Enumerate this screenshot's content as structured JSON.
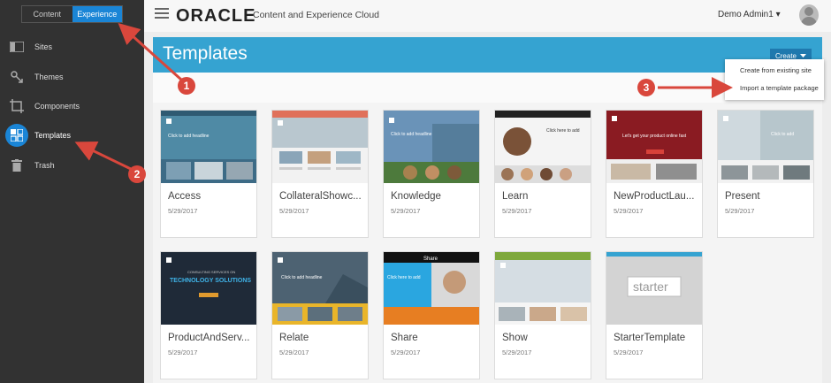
{
  "sidebar": {
    "switch": {
      "content": "Content",
      "experience": "Experience"
    },
    "items": [
      {
        "label": "Sites",
        "icon": "sites-icon"
      },
      {
        "label": "Themes",
        "icon": "themes-icon"
      },
      {
        "label": "Components",
        "icon": "components-icon"
      },
      {
        "label": "Templates",
        "icon": "templates-icon"
      },
      {
        "label": "Trash",
        "icon": "trash-icon"
      }
    ]
  },
  "header": {
    "brand": "ORACLE",
    "brand_sub": "Content and Experience Cloud",
    "user": "Demo Admin1 ▾"
  },
  "banner": {
    "title": "Templates",
    "create": "Create"
  },
  "dropdown": {
    "items": [
      "Create from existing site",
      "Import a template package"
    ]
  },
  "templates": [
    {
      "name": "Access",
      "date": "5/29/2017"
    },
    {
      "name": "CollateralShowc...",
      "date": "5/29/2017"
    },
    {
      "name": "Knowledge",
      "date": "5/29/2017"
    },
    {
      "name": "Learn",
      "date": "5/29/2017"
    },
    {
      "name": "NewProductLau...",
      "date": "5/29/2017"
    },
    {
      "name": "Present",
      "date": "5/29/2017"
    },
    {
      "name": "ProductAndServ...",
      "date": "5/29/2017"
    },
    {
      "name": "Relate",
      "date": "5/29/2017"
    },
    {
      "name": "Share",
      "date": "5/29/2017"
    },
    {
      "name": "Show",
      "date": "5/29/2017"
    },
    {
      "name": "StarterTemplate",
      "date": "5/29/2017"
    }
  ],
  "thumb_text": {
    "headline": "Click here to add headline",
    "tech_top": "CONSULTING SERVICES ON",
    "tech_main": "TECHNOLOGY SOLUTIONS",
    "share_title": "Share",
    "starter": "starter"
  },
  "callouts": [
    "1",
    "2",
    "3"
  ],
  "colors": {
    "accent": "#1a85d6",
    "banner": "#35a3d1",
    "callout": "#d9473c"
  }
}
